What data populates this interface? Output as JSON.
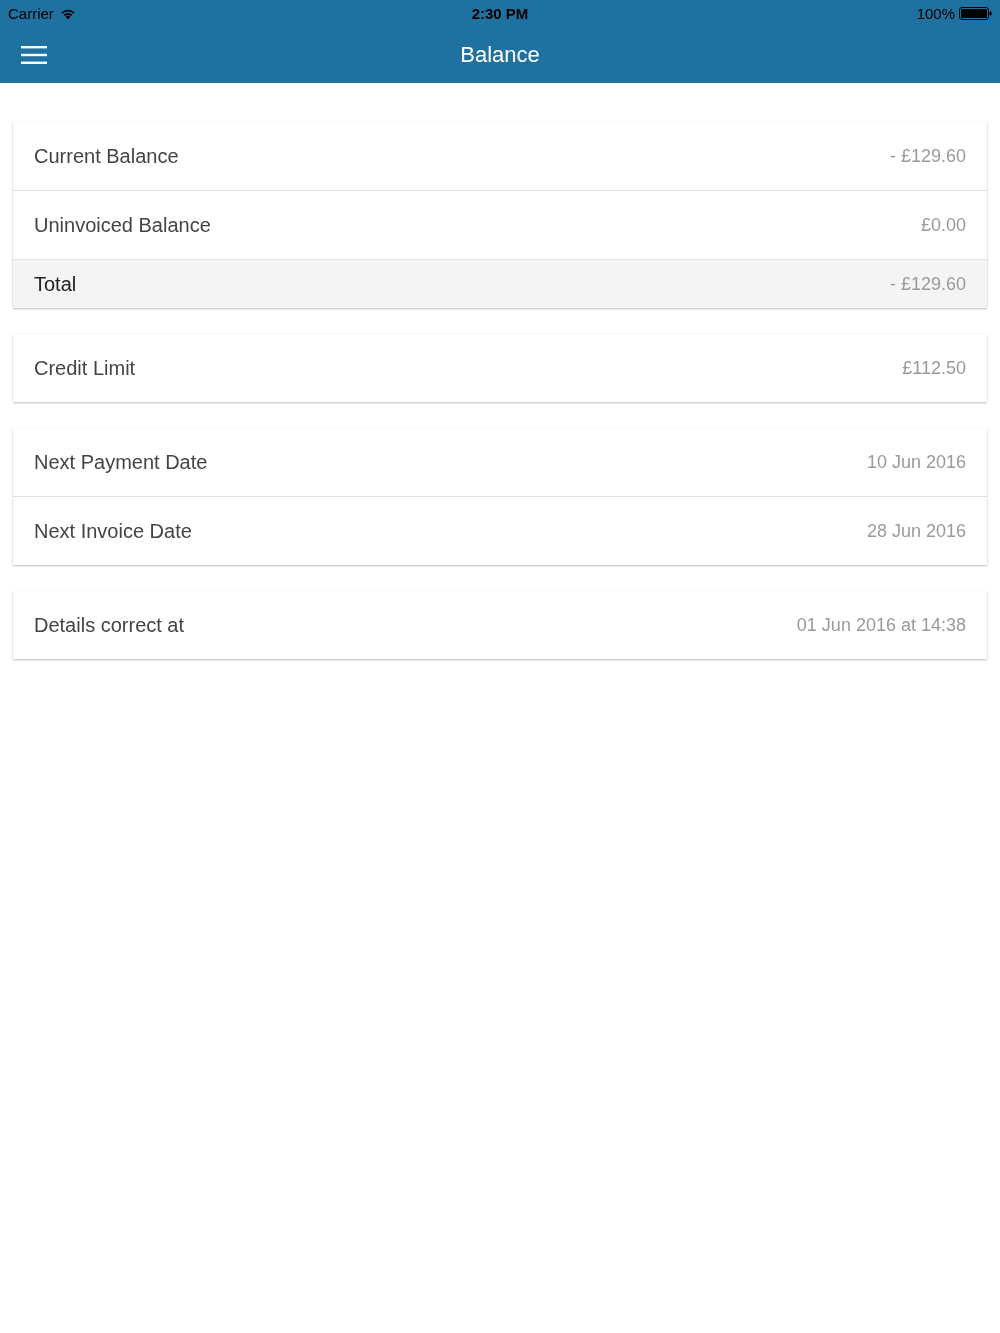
{
  "status_bar": {
    "carrier": "Carrier",
    "time": "2:30 PM",
    "battery": "100%"
  },
  "header": {
    "title": "Balance"
  },
  "cards": [
    {
      "rows": [
        {
          "kind": "item",
          "label": "Current Balance",
          "value": "- £129.60"
        },
        {
          "kind": "item",
          "label": "Uninvoiced Balance",
          "value": "£0.00"
        },
        {
          "kind": "total",
          "label": "Total",
          "value": "- £129.60"
        }
      ]
    },
    {
      "rows": [
        {
          "kind": "item",
          "label": "Credit Limit",
          "value": "£112.50"
        }
      ]
    },
    {
      "rows": [
        {
          "kind": "item",
          "label": "Next Payment Date",
          "value": "10 Jun 2016"
        },
        {
          "kind": "item",
          "label": "Next Invoice Date",
          "value": "28 Jun 2016"
        }
      ]
    },
    {
      "rows": [
        {
          "kind": "item",
          "label": "Details correct at",
          "value": "01 Jun 2016 at 14:38"
        }
      ]
    }
  ]
}
